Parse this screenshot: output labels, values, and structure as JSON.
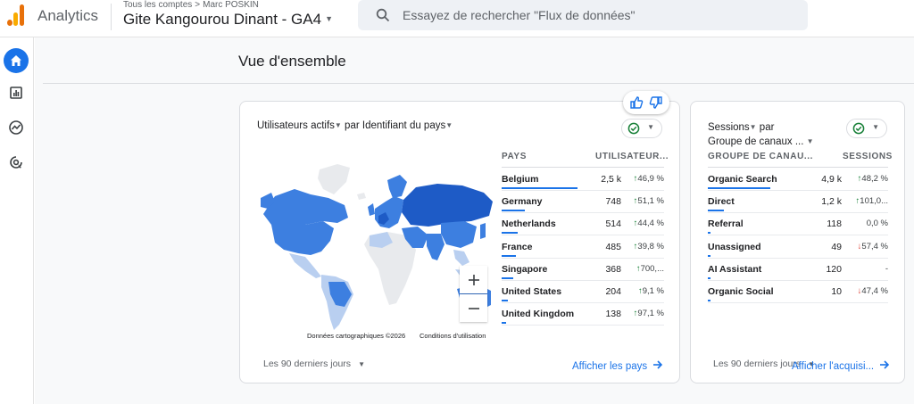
{
  "app": {
    "name": "Analytics"
  },
  "breadcrumb": {
    "accounts": "Tous les comptes",
    "account": "Marc POSKIN"
  },
  "property": {
    "name": "Gite Kangourou Dinant - GA4"
  },
  "search": {
    "placeholder": "Essayez de rechercher \"Flux de données\""
  },
  "rail": {
    "icons": [
      "home-icon",
      "reports-icon",
      "explore-icon",
      "advertising-icon"
    ]
  },
  "page": {
    "title": "Vue d'ensemble"
  },
  "card1": {
    "metric": "Utilisateurs actifs",
    "by": "par",
    "dimension": "Identifiant du pays",
    "col_dim": "PAYS",
    "col_metric": "UTILISATEUR...",
    "rows": [
      {
        "name": "Belgium",
        "value": "2,5 k",
        "dir": "up",
        "change": "46,9 %",
        "share": 1.0
      },
      {
        "name": "Germany",
        "value": "748",
        "dir": "up",
        "change": "51,1 %",
        "share": 0.3
      },
      {
        "name": "Netherlands",
        "value": "514",
        "dir": "up",
        "change": "44,4 %",
        "share": 0.21
      },
      {
        "name": "France",
        "value": "485",
        "dir": "up",
        "change": "39,8 %",
        "share": 0.19
      },
      {
        "name": "Singapore",
        "value": "368",
        "dir": "up",
        "change": "700,...",
        "share": 0.15
      },
      {
        "name": "United States",
        "value": "204",
        "dir": "up",
        "change": "9,1 %",
        "share": 0.08
      },
      {
        "name": "United Kingdom",
        "value": "138",
        "dir": "up",
        "change": "97,1 %",
        "share": 0.06
      }
    ],
    "map_attrib_left": "Données cartographiques ©2026",
    "map_attrib_right": "Conditions d'utilisation",
    "range": "Les 90 derniers jours",
    "link": "Afficher les pays"
  },
  "card2": {
    "metric": "Sessions",
    "by": "par",
    "dimension": "Groupe de canaux ...",
    "col_dim": "GROUPE DE CANAU...",
    "col_metric": "SESSIONS",
    "rows": [
      {
        "name": "Organic Search",
        "value": "4,9 k",
        "dir": "up",
        "change": "48,2 %",
        "share": 1.0
      },
      {
        "name": "Direct",
        "value": "1,2 k",
        "dir": "up",
        "change": "101,0...",
        "share": 0.25
      },
      {
        "name": "Referral",
        "value": "118",
        "dir": "none",
        "change": "0,0 %",
        "share": 0.03
      },
      {
        "name": "Unassigned",
        "value": "49",
        "dir": "down",
        "change": "57,4 %",
        "share": 0.02
      },
      {
        "name": "AI Assistant",
        "value": "120",
        "dir": "none",
        "change": "-",
        "share": 0.03
      },
      {
        "name": "Organic Social",
        "value": "10",
        "dir": "down",
        "change": "47,4 %",
        "share": 0.01
      }
    ],
    "range": "Les 90 derniers jours",
    "link": "Afficher l'acquisi..."
  },
  "colors": {
    "accent": "#1a73e8",
    "up": "#188038",
    "down": "#d93025",
    "map_dark": "#1e5bc6",
    "map_mid": "#3d7fe0",
    "map_light": "#b9cff0",
    "map_none": "#e8eaed"
  }
}
